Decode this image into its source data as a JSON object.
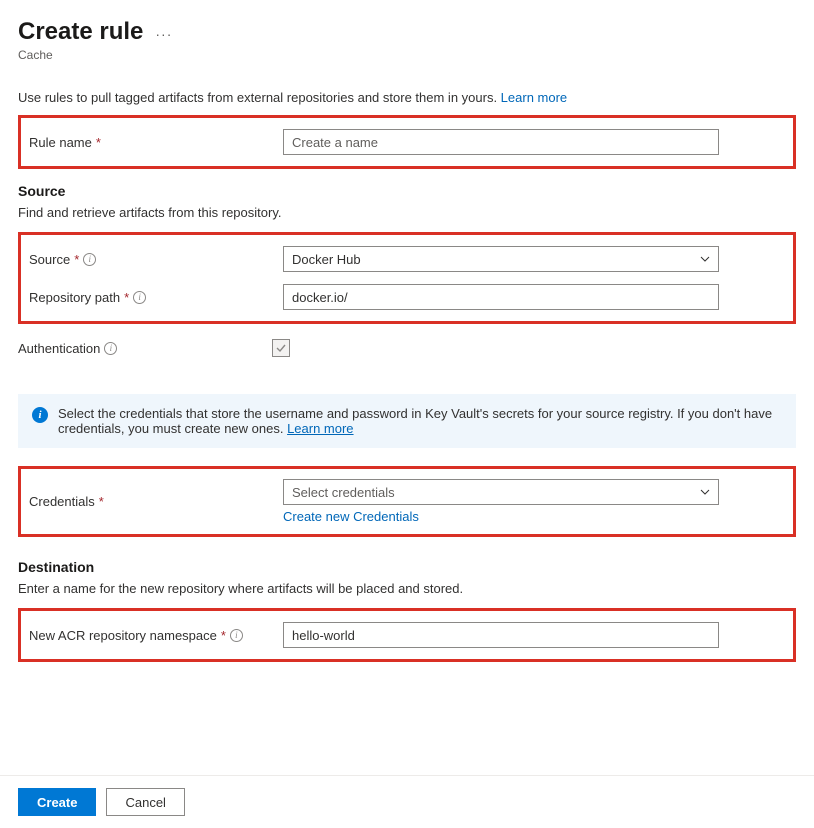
{
  "header": {
    "title": "Create rule",
    "subtitle": "Cache"
  },
  "intro": {
    "text": "Use rules to pull tagged artifacts from external repositories and store them in yours. ",
    "learn_more": "Learn more"
  },
  "fields": {
    "rule_name": {
      "label": "Rule name",
      "placeholder": "Create a name",
      "value": ""
    },
    "source_section": {
      "heading": "Source",
      "desc": "Find and retrieve artifacts from this repository."
    },
    "source": {
      "label": "Source",
      "selected": "Docker Hub"
    },
    "repo_path": {
      "label": "Repository path",
      "value": "docker.io/"
    },
    "authentication": {
      "label": "Authentication"
    },
    "credentials": {
      "label": "Credentials",
      "placeholder": "Select credentials",
      "create_link": "Create new Credentials"
    },
    "destination_section": {
      "heading": "Destination",
      "desc": "Enter a name for the new repository where artifacts will be placed and stored."
    },
    "namespace": {
      "label": "New ACR repository namespace",
      "value": "hello-world"
    }
  },
  "banner": {
    "text": "Select the credentials that store the username and password in Key Vault's secrets for your source registry. If you don't have credentials, you must create new ones. ",
    "learn_more": "Learn more"
  },
  "footer": {
    "create": "Create",
    "cancel": "Cancel"
  }
}
